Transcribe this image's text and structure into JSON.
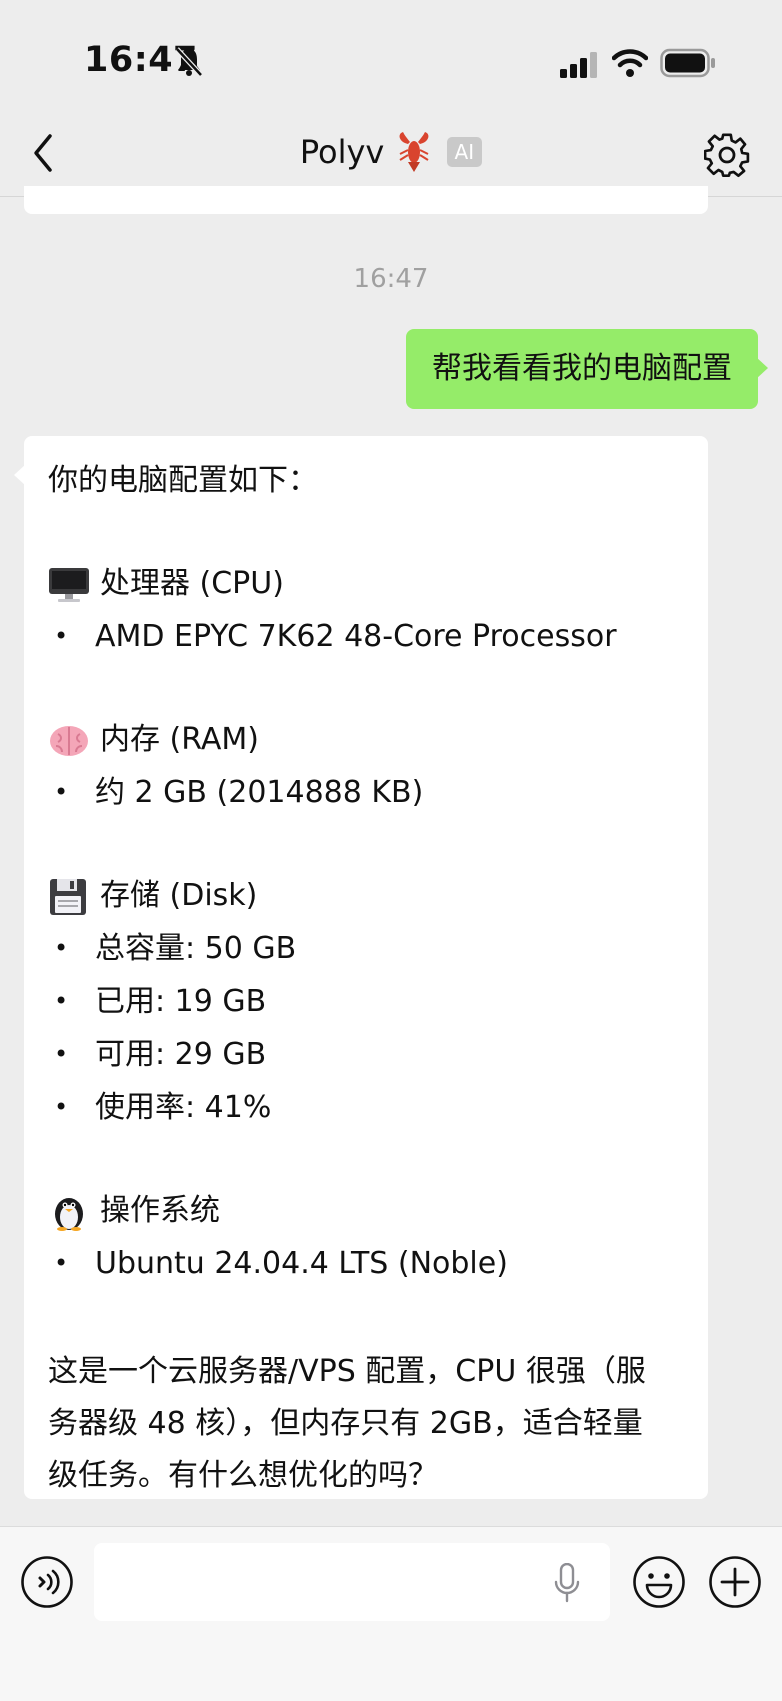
{
  "status_bar": {
    "time": "16:47"
  },
  "nav": {
    "title": "Polyv",
    "badge": "AI"
  },
  "chat": {
    "timestamp": "16:47",
    "user_message": "帮我看看我的电脑配置",
    "reply": {
      "intro": "你的电脑配置如下：",
      "sections": [
        {
          "icon": "desktop-computer-icon",
          "heading": "处理器 (CPU)",
          "items": [
            "AMD EPYC 7K62 48-Core Processor"
          ]
        },
        {
          "icon": "brain-icon",
          "heading": "内存 (RAM)",
          "items": [
            "约 2 GB (2014888 KB)"
          ]
        },
        {
          "icon": "floppy-disk-icon",
          "heading": "存储 (Disk)",
          "items": [
            "总容量: 50 GB",
            "已用: 19 GB",
            "可用: 29 GB",
            "使用率: 41%"
          ]
        },
        {
          "icon": "penguin-icon",
          "heading": "操作系统",
          "items": [
            "Ubuntu 24.04.4 LTS (Noble)"
          ]
        }
      ],
      "summary_lines": [
        "这是一个云服务器/VPS 配置，CPU 很强（服",
        "务器级 48 核），但内存只有 2GB，适合轻量",
        "级任务。有什么想优化的吗？"
      ]
    }
  },
  "input": {
    "placeholder": "",
    "value": ""
  },
  "colors": {
    "user_bubble": "#95ec69",
    "background": "#ededed",
    "ai_bubble": "#ffffff"
  }
}
